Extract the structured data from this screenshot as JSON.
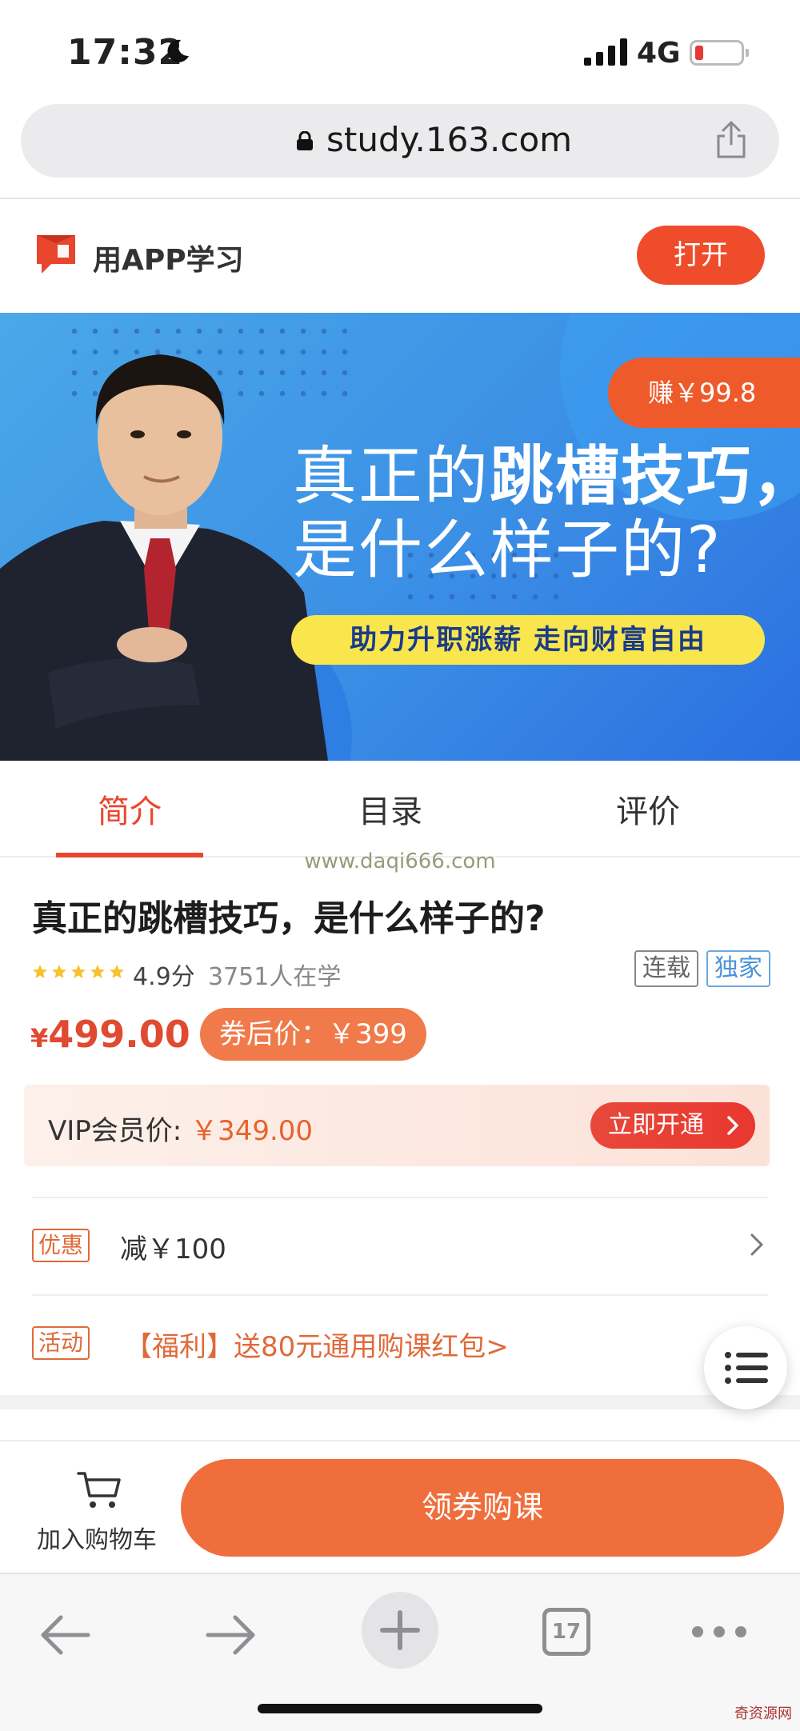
{
  "status_bar": {
    "time": "17:32",
    "network": "4G"
  },
  "browser": {
    "url": "study.163.com",
    "tab_count": "17"
  },
  "app_promo": {
    "text": "用APP学习",
    "open_button": "打开"
  },
  "banner": {
    "earn_badge": "赚￥99.8",
    "headline_part1": "真正的",
    "headline_part2": "跳槽技巧，",
    "headline_line2": "是什么样子的?",
    "slogan": "助力升职涨薪  走向财富自由"
  },
  "tabs": [
    {
      "label": "简介",
      "active": true
    },
    {
      "label": "目录",
      "active": false
    },
    {
      "label": "评价",
      "active": false
    }
  ],
  "watermark": "www.daqi666.com",
  "course": {
    "title": "真正的跳槽技巧，是什么样子的?",
    "rating": 4.9,
    "rating_text": "4.9分",
    "learners": "3751人在学",
    "tags": [
      "连载",
      "独家"
    ],
    "price_symbol": "¥",
    "price": "499.00",
    "coupon_price": "券后价：￥399"
  },
  "vip": {
    "label": "VIP会员价: ",
    "price": "￥349.00",
    "button": "立即开通"
  },
  "offers": [
    {
      "tag": "优惠",
      "text": "减￥100"
    },
    {
      "tag": "活动",
      "text": "【福利】送80元通用购课红包>"
    }
  ],
  "buy_bar": {
    "cart_label": "加入购物车",
    "buy_button": "领券购课"
  },
  "footer_brand": "奇资源网",
  "colors": {
    "accent": "#e8472e",
    "button_orange": "#ef6e3b",
    "banner_blue": "#3b8fe5"
  }
}
